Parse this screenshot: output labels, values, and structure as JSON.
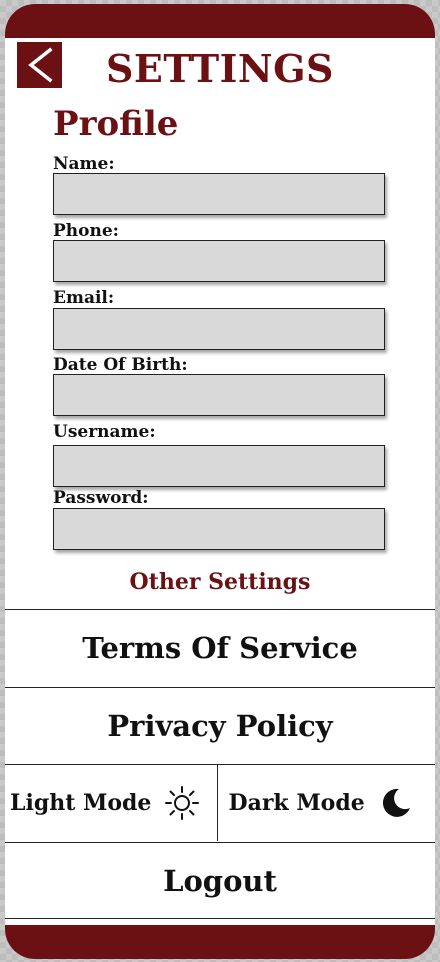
{
  "header": {
    "title": "SETTINGS",
    "back_icon": "chevron-left-icon"
  },
  "profile": {
    "title": "Profile",
    "fields": [
      {
        "label": "Name:",
        "value": ""
      },
      {
        "label": "Phone:",
        "value": ""
      },
      {
        "label": "Email:",
        "value": ""
      },
      {
        "label": "Date Of Birth:",
        "value": ""
      },
      {
        "label": "Username:",
        "value": ""
      },
      {
        "label": "Password:",
        "value": ""
      }
    ]
  },
  "other_settings": {
    "title": "Other Settings",
    "terms_label": "Terms Of Service",
    "privacy_label": "Privacy Policy",
    "light_mode_label": "Light Mode",
    "light_mode_icon": "sun-icon",
    "dark_mode_label": "Dark Mode",
    "dark_mode_icon": "moon-icon",
    "logout_label": "Logout"
  },
  "colors": {
    "accent": "#6b1113",
    "input_bg": "#d9d9d9"
  }
}
